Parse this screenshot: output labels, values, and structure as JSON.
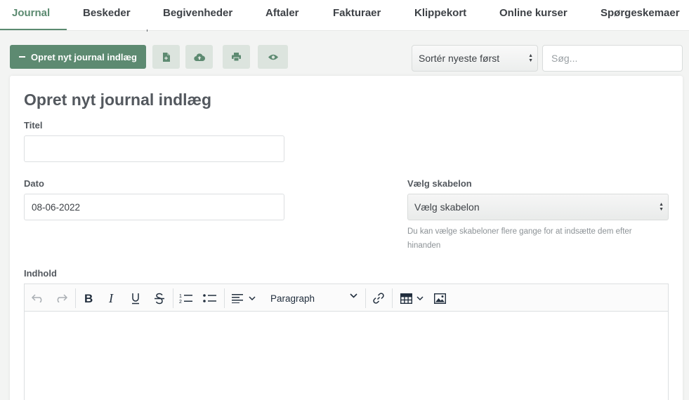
{
  "tabs": [
    {
      "label": "Journal",
      "active": true
    },
    {
      "label": "Beskeder"
    },
    {
      "label": "Begivenheder"
    },
    {
      "label": "Aftaler"
    },
    {
      "label": "Fakturaer"
    },
    {
      "label": "Klippekort"
    },
    {
      "label": "Online kurser"
    },
    {
      "label": "Spørgeskemaer"
    }
  ],
  "toolbar": {
    "create_label": "Opret nyt journal indlæg",
    "icons": [
      "file-export-icon",
      "cloud-upload-icon",
      "print-icon",
      "eye-icon"
    ],
    "sort_value": "Sortér nyeste først",
    "search_placeholder": "Søg..."
  },
  "form": {
    "heading": "Opret nyt journal indlæg",
    "title_label": "Titel",
    "title_value": "",
    "date_label": "Dato",
    "date_value": "08-06-2022",
    "template_label": "Vælg skabelon",
    "template_value": "Vælg skabelon",
    "template_hint": "Du kan vælge skabeloner flere gange for at indsætte dem efter hinanden",
    "content_label": "Indhold"
  },
  "editor": {
    "block_format": "Paragraph"
  },
  "colors": {
    "accent": "#5d8a71",
    "light_button": "#dce4de",
    "background": "#f3f4f3"
  }
}
